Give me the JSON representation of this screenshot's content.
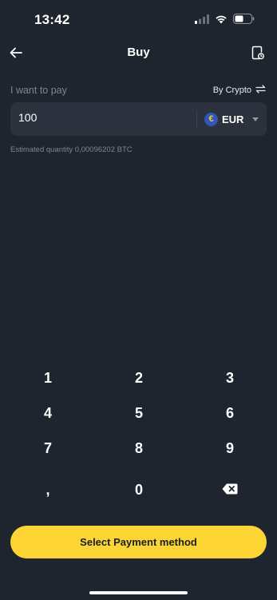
{
  "status_bar": {
    "time": "13:42"
  },
  "header": {
    "title": "Buy",
    "back_icon": "arrow-left-icon",
    "history_icon": "history-icon"
  },
  "pay": {
    "label": "I want to pay",
    "mode_toggle": "By Crypto",
    "amount": "100",
    "currency": "EUR",
    "currency_symbol": "€",
    "estimate": "Estimated quantity 0,00096202 BTC"
  },
  "keypad": {
    "keys": [
      "1",
      "2",
      "3",
      "4",
      "5",
      "6",
      "7",
      "8",
      "9",
      ",",
      "0"
    ],
    "backspace_icon": "backspace-icon"
  },
  "cta": {
    "label": "Select Payment method"
  },
  "colors": {
    "background": "#1f252e",
    "field": "#2b323d",
    "accent": "#fcd535",
    "muted_text": "#7c8591"
  }
}
